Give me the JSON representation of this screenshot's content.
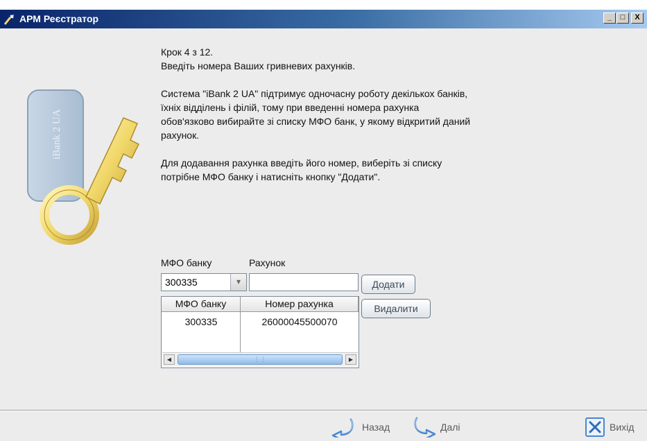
{
  "window": {
    "title": "АРМ Реєстратор",
    "controls": {
      "minimize": "_",
      "maximize": "□",
      "close": "X"
    }
  },
  "illustration": {
    "card_text": "iBank 2 UA"
  },
  "instructions": {
    "step": "Крок 4 з 12.",
    "heading": "Введіть номера Ваших гривневих рахунків.",
    "paragraph1_lines": [
      "Система \"iBank 2 UA\" підтримує одночасну роботу декількох банків,",
      "їхніх відділень і філій, тому при введенні номера рахунка",
      "обов'язково вибирайте зі списку МФО банк, у якому відкритий даний",
      "рахунок."
    ],
    "paragraph2_lines": [
      "Для додавання рахунка введіть його номер, виберіть зі списку",
      "потрібне МФО банку і натисніть кнопку \"Додати\"."
    ]
  },
  "form": {
    "mfo_label": "МФО банку",
    "account_label": "Рахунок",
    "mfo_selected": "300335",
    "account_value": "",
    "add_button": "Додати",
    "delete_button": "Видалити"
  },
  "table": {
    "columns": [
      "МФО банку",
      "Номер рахунка"
    ],
    "rows": [
      {
        "mfo": "300335",
        "account": "26000045500070"
      }
    ]
  },
  "footer": {
    "back_label": "Назад",
    "next_label": "Далі",
    "exit_label": "Вихід"
  },
  "colors": {
    "titlebar_start": "#0a246a",
    "titlebar_end": "#a6caf0",
    "window_bg": "#ececec",
    "accent_blue": "#3b78c4"
  }
}
